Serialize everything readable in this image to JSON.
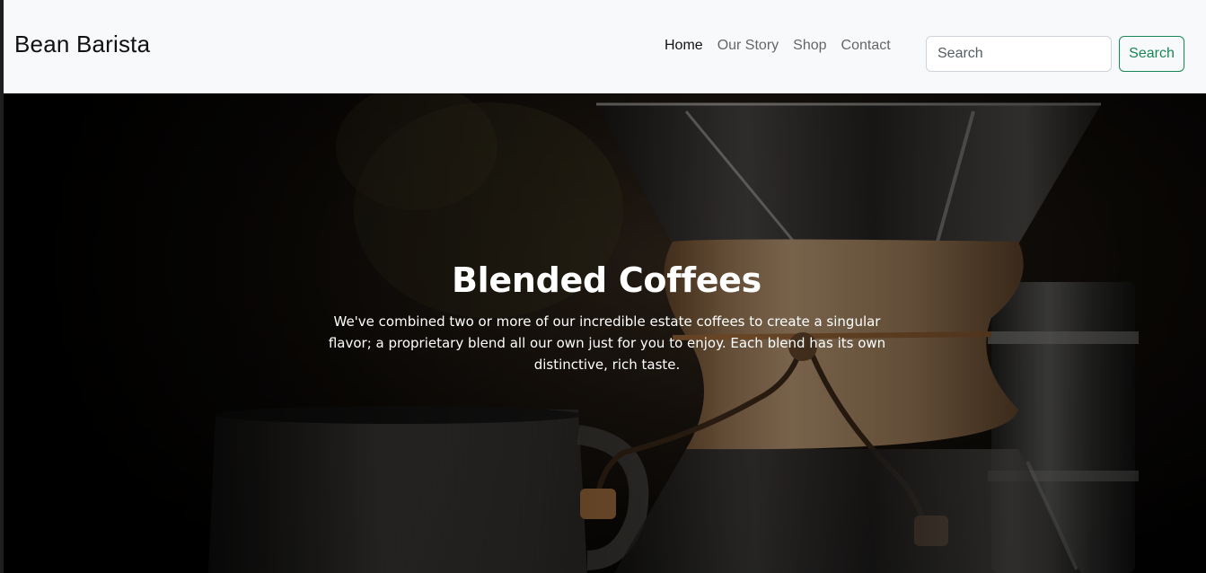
{
  "brand": {
    "name": "Bean Barista"
  },
  "nav": {
    "items": [
      {
        "label": "Home",
        "active": true
      },
      {
        "label": "Our Story",
        "active": false
      },
      {
        "label": "Shop",
        "active": false
      },
      {
        "label": "Contact",
        "active": false
      }
    ]
  },
  "search": {
    "placeholder": "Search",
    "value": "",
    "button_label": "Search"
  },
  "hero": {
    "title": "Blended Coffees",
    "text": "We've combined two or more of our incredible estate coffees to create a singular flavor; a proprietary blend all our own just for you to enjoy. Each blend has its own distinctive, rich taste.",
    "image": "coffee-chemex-with-mug"
  },
  "colors": {
    "navbar_bg": "#f8f9fa",
    "accent_success": "#198754",
    "hero_overlay": "#000000"
  }
}
